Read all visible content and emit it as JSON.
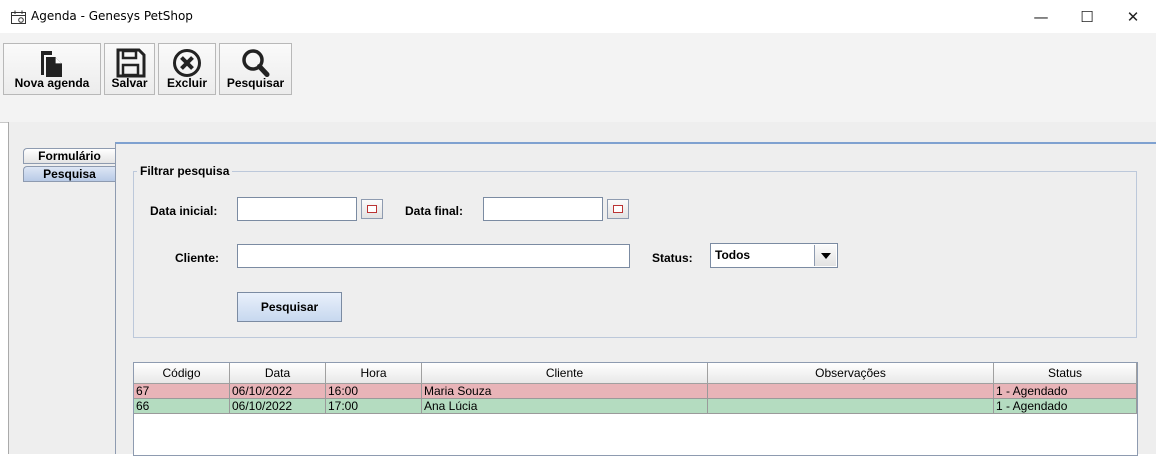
{
  "window": {
    "title": "Agenda - Genesys PetShop",
    "controls": {
      "minimize": "—",
      "maximize": "☐",
      "close": "✕"
    }
  },
  "toolbar": {
    "nova_label": "Nova agenda",
    "salvar_label": "Salvar",
    "excluir_label": "Excluir",
    "pesquisar_label": "Pesquisar"
  },
  "tabs": {
    "formulario": "Formulário",
    "pesquisa": "Pesquisa",
    "selected": "Pesquisa"
  },
  "filter": {
    "legend": "Filtrar pesquisa",
    "data_inicial_label": "Data inicial:",
    "data_inicial_value": "",
    "data_final_label": "Data final:",
    "data_final_value": "",
    "cliente_label": "Cliente:",
    "cliente_value": "",
    "status_label": "Status:",
    "status_value": "Todos",
    "search_button": "Pesquisar"
  },
  "table": {
    "columns": [
      "Código",
      "Data",
      "Hora",
      "Cliente",
      "Observações",
      "Status"
    ],
    "rows": [
      {
        "codigo": "67",
        "data": "06/10/2022",
        "hora": "16:00",
        "cliente": "Maria Souza",
        "observacoes": "",
        "status": "1 - Agendado",
        "color": "#e8b4b8"
      },
      {
        "codigo": "66",
        "data": "06/10/2022",
        "hora": "17:00",
        "cliente": "Ana Lúcia",
        "observacoes": "",
        "status": "1 - Agendado",
        "color": "#b4dcc0"
      }
    ]
  },
  "colors": {
    "row_pink": "#e8b4b8",
    "row_green": "#b4dcc0",
    "tab_selected": "#b8cae6",
    "content_border": "#7fa1d0"
  }
}
